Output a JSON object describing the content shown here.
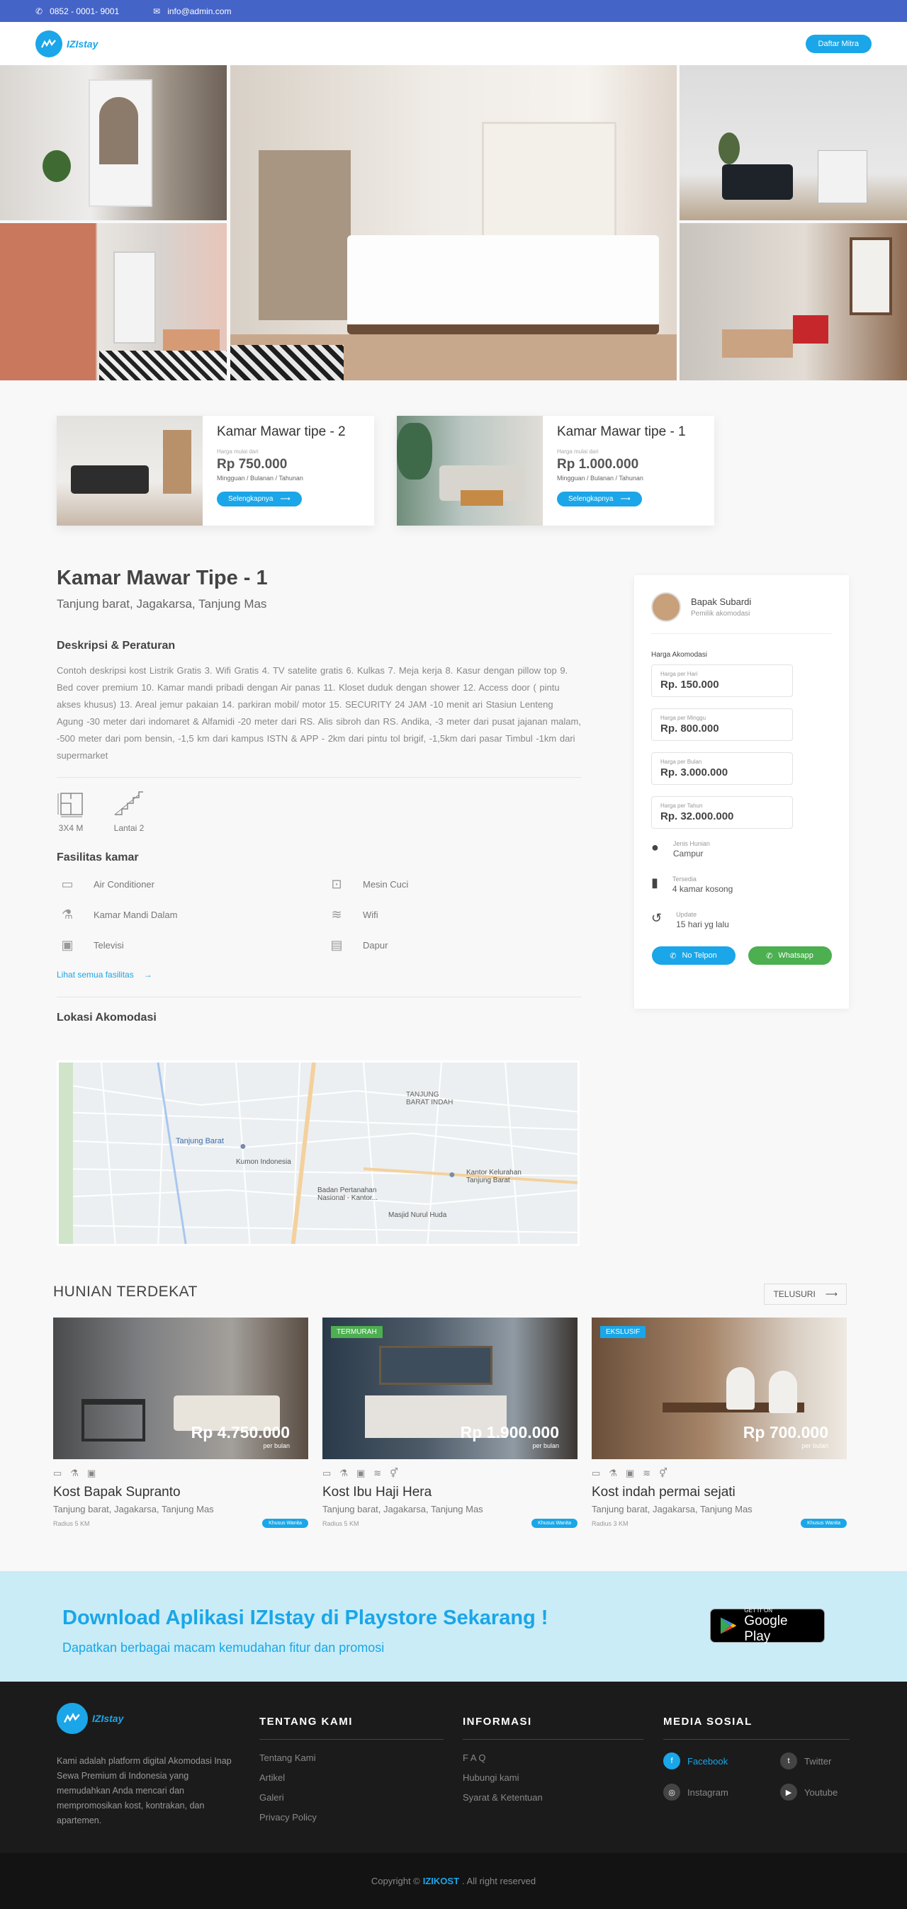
{
  "topbar": {
    "phone": "0852 - 0001- 9001",
    "email": "info@admin.com"
  },
  "nav": {
    "logo": "IZIstay",
    "cta": "Daftar Mitra"
  },
  "room_cards": [
    {
      "title": "Kamar Mawar tipe - 2",
      "price_label": "Harga mulai dari",
      "price": "Rp 750.000",
      "period": "Mingguan / Bulanan / Tahunan",
      "button": "Selengkapnya"
    },
    {
      "title": "Kamar Mawar tipe - 1",
      "price_label": "Harga mulai dari",
      "price": "Rp 1.000.000",
      "period": "Mingguan / Bulanan / Tahunan",
      "button": "Selengkapnya"
    }
  ],
  "detail": {
    "title": "Kamar Mawar Tipe - 1",
    "address": "Tanjung barat, Jagakarsa, Tanjung Mas",
    "desc_heading": "Deskripsi & Peraturan",
    "description": "Contoh deskripsi kost Listrik Gratis   3. Wifi Gratis   4. TV satelite gratis   6. Kulkas   7. Meja kerja       8. Kasur dengan pillow top   9. Bed cover premium   10. Kamar mandi pribadi dengan Air panas       11. Kloset duduk dengan shower   12. Access door ( pintu akses khusus)   13. Areal jemur pakaian       14. parkiran mobil/ motor   15. SECURITY 24 JAM      -10 menit ari Stasiun Lenteng Agung   -30 meter dari indomaret & Alfamidi   -20 meter dari RS. Alis sibroh dan RS. Andika,    -3 meter dari pusat jajanan malam,    -500 meter dari pom bensin,    -1,5 km dari kampus ISTN & APP    - 2km dari pintu tol brigif,    -1,5km dari pasar Timbul   -1km dari supermarket",
    "size": "3X4 M",
    "floor": "Lantai 2",
    "facilities_heading": "Fasilitas kamar",
    "facilities": [
      "Air Conditioner",
      "Mesin Cuci",
      "Kamar Mandi Dalam",
      "Wifi",
      "Televisi",
      "Dapur"
    ],
    "see_all": "Lihat semua fasilitas",
    "location_heading": "Lokasi Akomodasi"
  },
  "map_labels": [
    "TANJUNG BARAT INDAH",
    "Tanjung Barat",
    "Kumon Indonesia",
    "Badan Pertanahan Nasional - Kantor...",
    "Kantor Kelurahan Tanjung Barat",
    "Masjid Nurul Huda"
  ],
  "sidebar": {
    "owner_name": "Bapak Subardi",
    "owner_role": "Pemilik akomodasi",
    "price_heading": "Harga Akomodasi",
    "prices": [
      {
        "label": "Harga per Hari",
        "value": "Rp. 150.000"
      },
      {
        "label": "Harga per Minggu",
        "value": "Rp. 800.000"
      },
      {
        "label": "Harga per Bulan",
        "value": "Rp. 3.000.000"
      },
      {
        "label": "Harga per Tahun",
        "value": "Rp. 32.000.000"
      }
    ],
    "info": [
      {
        "label": "Jenis Hunian",
        "value": "Campur",
        "icon": "person-icon"
      },
      {
        "label": "Tersedia",
        "value": "4 kamar kosong",
        "icon": "door-icon"
      },
      {
        "label": "Update",
        "value": "15 hari yg lalu",
        "icon": "history-icon"
      }
    ],
    "phone_btn": "No Telpon",
    "wa_btn": "Whatsapp"
  },
  "nearby": {
    "heading": "HUNIAN TERDEKAT",
    "browse": "TELUSURI",
    "items": [
      {
        "name": "Kost Bapak Supranto",
        "address": "Tanjung barat, Jagakarsa, Tanjung Mas",
        "radius": "Radius 5 KM",
        "price": "Rp 4.750.000",
        "per": "per bulan",
        "badge": "",
        "tag": "Khusus Wanita"
      },
      {
        "name": "Kost Ibu Haji Hera",
        "address": "Tanjung barat, Jagakarsa, Tanjung Mas",
        "radius": "Radius 5 KM",
        "price": "Rp 1.900.000",
        "per": "per bulan",
        "badge": "TERMURAH",
        "tag": "Khusus Wanita"
      },
      {
        "name": "Kost indah permai sejati",
        "address": "Tanjung barat, Jagakarsa, Tanjung Mas",
        "radius": "Radius 3 KM",
        "price": "Rp 700.000",
        "per": "per bulan",
        "badge": "EKSLUSIF",
        "tag": "Khusus Wanita"
      }
    ]
  },
  "promo": {
    "title": "Download Aplikasi IZIstay di Playstore Sekarang !",
    "subtitle": "Dapatkan berbagai macam kemudahan fitur dan promosi",
    "store_small": "GET IT ON",
    "store_big": "Google Play"
  },
  "footer": {
    "logo": "IZIstay",
    "about": "Kami adalah platform digital Akomodasi Inap Sewa Premium di Indonesia yang memudahkan Anda mencari dan mempromosikan kost, kontrakan, dan apartemen.",
    "col1_title": "TENTANG KAMI",
    "col1": [
      "Tentang Kami",
      "Artikel",
      "Galeri",
      "Privacy Policy"
    ],
    "col2_title": "INFORMASI",
    "col2": [
      "F A Q",
      "Hubungi kami",
      "Syarat & Ketentuan"
    ],
    "col3_title": "MEDIA SOSIAL",
    "social": [
      "Facebook",
      "Twitter",
      "Instagram",
      "Youtube"
    ],
    "copy_prefix": "Copyright ©",
    "copy_brand": "IZIKOST",
    "copy_suffix": ". All right reserved"
  },
  "colors": {
    "primary": "#1aa6e8",
    "topbar": "#4464c8",
    "whatsapp": "#4caf50",
    "badge_green": "#4caf50",
    "footer": "#1b1b1b"
  }
}
